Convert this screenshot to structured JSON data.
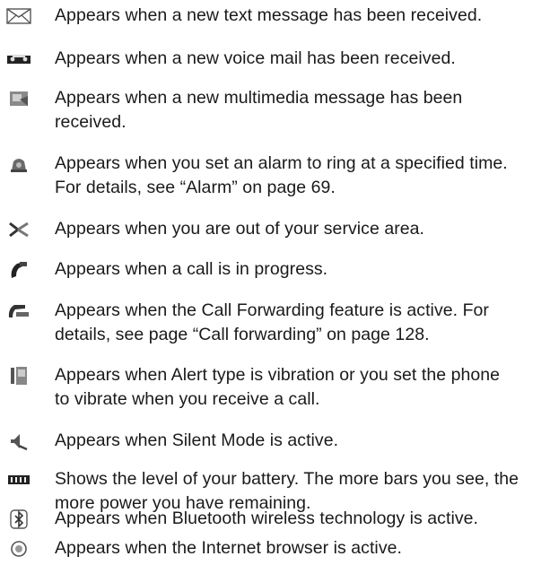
{
  "items": [
    {
      "icon": "envelope-icon",
      "lines": [
        "Appears when a new text message has been received."
      ]
    },
    {
      "icon": "voicemail-icon",
      "lines": [
        "Appears when a new voice mail has been received."
      ]
    },
    {
      "icon": "multimedia-message-icon",
      "lines": [
        "Appears when a new multimedia message has been",
        "received."
      ]
    },
    {
      "icon": "alarm-icon",
      "lines": [
        "Appears when you set an alarm to ring at a specified time.",
        "For details, see “Alarm” on page 69."
      ]
    },
    {
      "icon": "no-service-icon",
      "lines": [
        "Appears when you are out of your service area."
      ]
    },
    {
      "icon": "call-in-progress-icon",
      "lines": [
        "Appears when a call is in progress."
      ]
    },
    {
      "icon": "call-forwarding-icon",
      "lines": [
        "Appears when the Call Forwarding feature is active. For",
        "details, see page “Call forwarding” on page 128."
      ]
    },
    {
      "icon": "vibration-icon",
      "lines": [
        "Appears when Alert type is vibration or you set the phone",
        "to vibrate when you receive a call."
      ]
    },
    {
      "icon": "silent-mode-icon",
      "lines": [
        "Appears when Silent Mode is active."
      ]
    },
    {
      "icon": "battery-icon",
      "lines": [
        "Shows the level of your battery. The more bars you see, the",
        "more power you have remaining."
      ]
    },
    {
      "icon": "bluetooth-icon",
      "lines": [
        "Appears when Bluetooth wireless technology is active."
      ]
    },
    {
      "icon": "internet-browser-icon",
      "lines": [
        "Appears when the Internet browser is active."
      ]
    }
  ]
}
